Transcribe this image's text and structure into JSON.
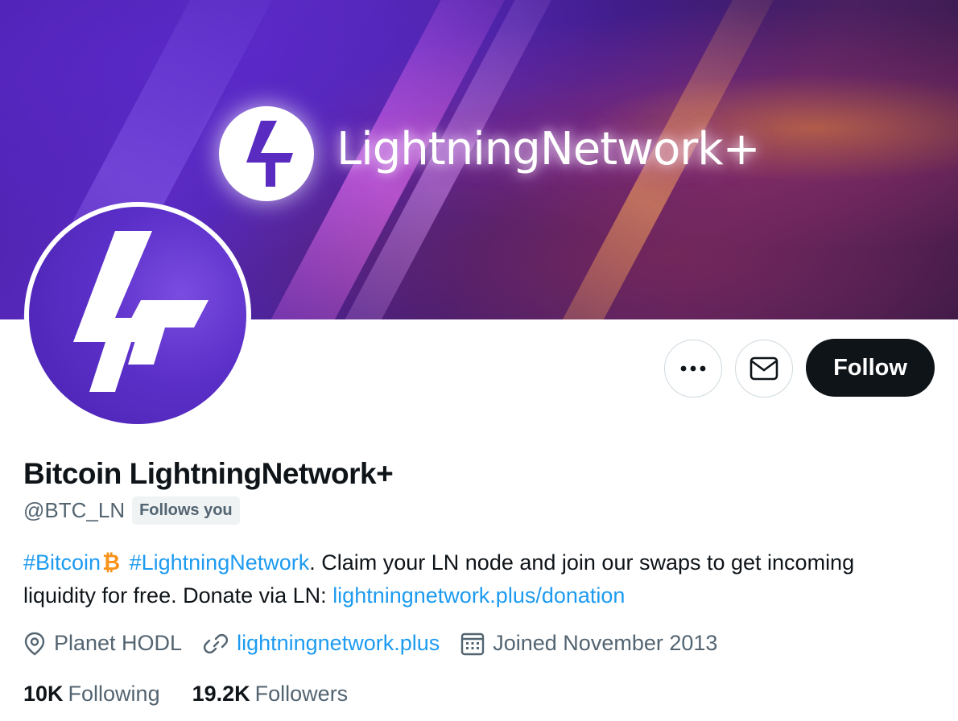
{
  "banner": {
    "title": "LightningNetwork+"
  },
  "profile": {
    "display_name": "Bitcoin LightningNetwork+",
    "handle": "@BTC_LN",
    "follows_you": "Follows you"
  },
  "actions": {
    "more_icon": "ellipsis-icon",
    "message_icon": "envelope-icon",
    "follow_label": "Follow"
  },
  "bio": {
    "hashtag_bitcoin": "#Bitcoin",
    "bitcoin_icon": "bitcoin-icon",
    "hashtag_ln": "#LightningNetwork",
    "text_part1": ". Claim your LN node and join our swaps to get incoming liquidity for free. Donate via LN: ",
    "donation_link": "lightningnetwork.plus/donation"
  },
  "meta": {
    "location": "Planet HODL",
    "website": "lightningnetwork.plus",
    "joined": "Joined November 2013"
  },
  "stats": {
    "following_count": "10K",
    "following_label": "Following",
    "followers_count": "19.2K",
    "followers_label": "Followers"
  },
  "colors": {
    "link": "#1d9bf0",
    "text_primary": "#0f1419",
    "text_secondary": "#536471",
    "bitcoin_orange": "#f7931a"
  }
}
